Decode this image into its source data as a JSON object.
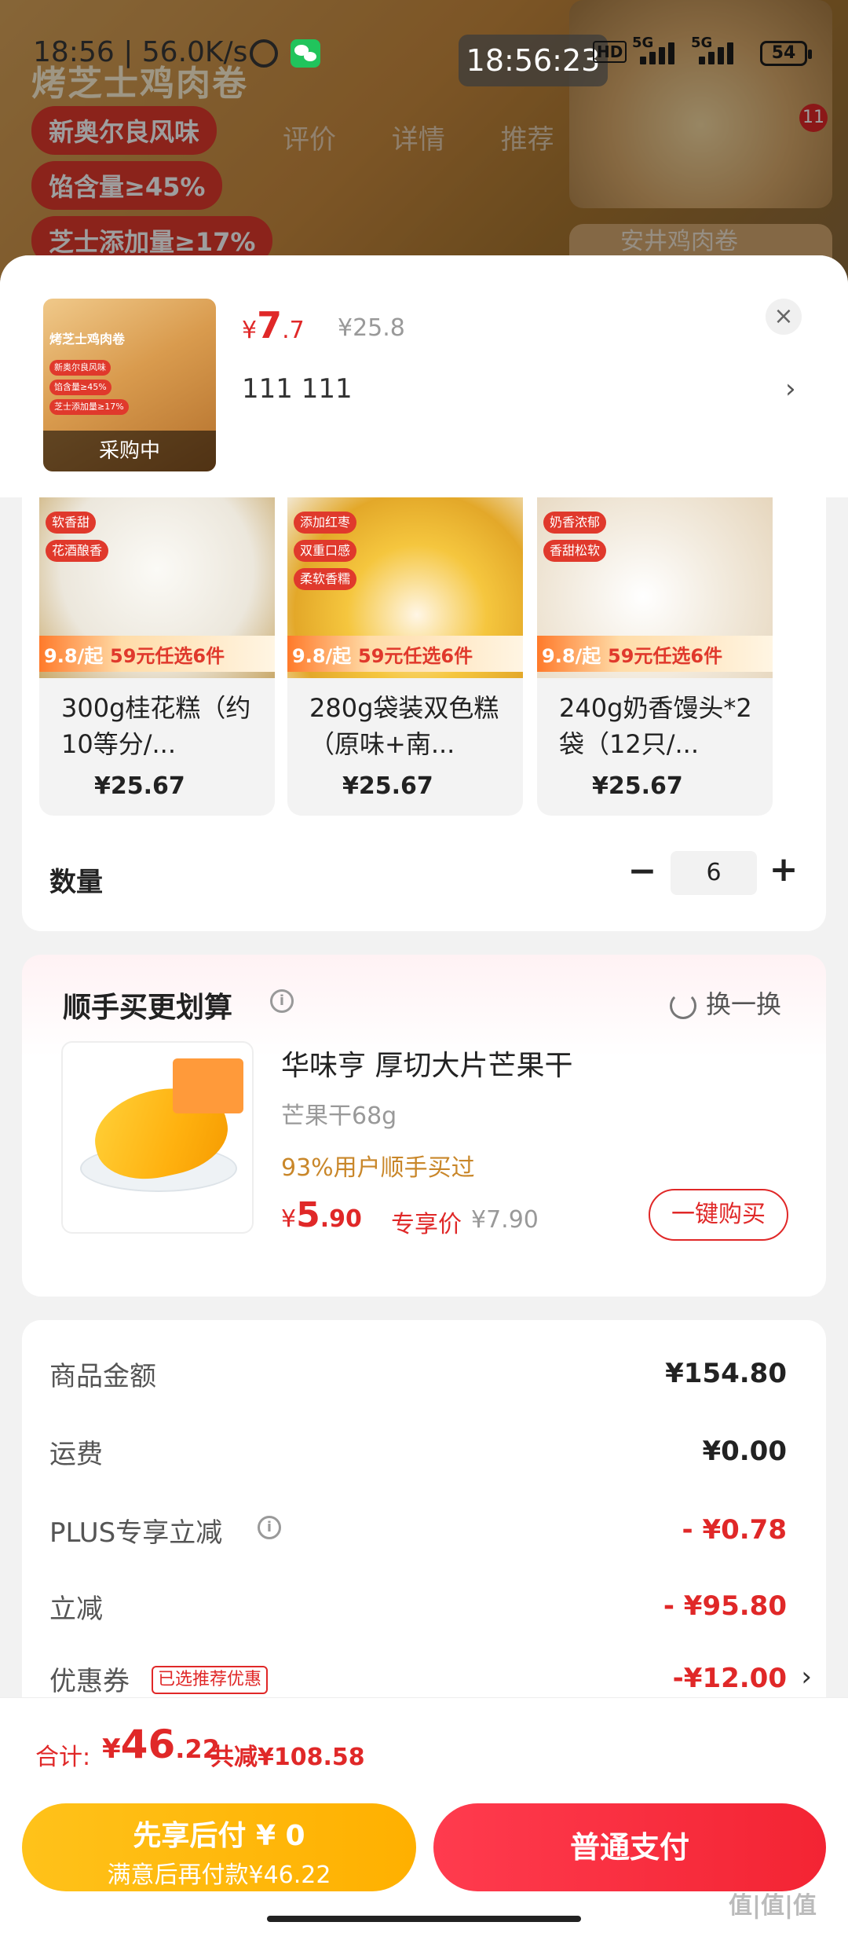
{
  "status_bar": {
    "left_text": "18:56 | 56.0K/s",
    "center_time": "18:56:23",
    "hd_label": "HD",
    "network_1": "5G",
    "network_2": "5G",
    "battery": "54"
  },
  "background": {
    "title": "烤芝士鸡肉卷",
    "badges": [
      "新奥尔良风味",
      "馅含量≥45%",
      "芝士添加量≥17%"
    ],
    "tabs_text": "评价 详情 推荐",
    "right_label": "安井鸡肉卷",
    "cart_count": "11"
  },
  "product_header": {
    "thumb_title": "烤芝士鸡肉卷",
    "thumb_chips": [
      "新奥尔良风味",
      "馅含量≥45%",
      "芝士添加量≥17%"
    ],
    "thumb_status": "采购中",
    "price_symbol": "¥",
    "price_int": "7",
    "price_dec": ".7",
    "price_original": "¥25.8",
    "selected_spec": "111  111",
    "chevron": "›",
    "close": "×"
  },
  "variants": [
    {
      "name": "300g桂花糕（约10等分/...",
      "price": "¥25.67",
      "tags": [
        "软香甜",
        "花酒酿香"
      ],
      "promo_price": "9.8/起",
      "promo_text": "59元任选6件",
      "color": "#e9e4da"
    },
    {
      "name": "280g袋装双色糕（原味+南...",
      "price": "¥25.67",
      "tags": [
        "添加红枣",
        "双重口感",
        "柔软香糯"
      ],
      "promo_price": "9.8/起",
      "promo_text": "59元任选6件",
      "color": "#f3c23a"
    },
    {
      "name": "240g奶香馒头*2袋（12只/...",
      "price": "¥25.67",
      "tags": [
        "奶香浓郁",
        "香甜松软"
      ],
      "promo_price": "9.8/起",
      "promo_text": "59元任选6件",
      "color": "#efe6d8"
    }
  ],
  "quantity": {
    "label": "数量",
    "minus": "−",
    "value": "6",
    "plus": "+"
  },
  "upsell": {
    "title": "顺手买更划算",
    "info_icon": "i",
    "refresh_label": "换一换",
    "product_name": "华味亨 厚切大片芒果干",
    "spec": "芒果干68g",
    "social_proof": "93%用户顺手买过",
    "price_symbol": "¥",
    "price_int": "5",
    "price_dec": ".90",
    "price_tag": "专享价",
    "price_original": "¥7.90",
    "buy_label": "一键购买"
  },
  "summary": {
    "rows": [
      {
        "label": "商品金额",
        "value": "¥154.80"
      },
      {
        "label": "运费",
        "value": "¥0.00"
      },
      {
        "label": "PLUS专享立减",
        "value": "- ¥0.78"
      },
      {
        "label": "立减",
        "value": "- ¥95.80"
      },
      {
        "label": "优惠券",
        "value": "-¥12.00"
      }
    ],
    "coupon_chip": "已选推荐优惠",
    "info_icon": "i",
    "chevron": "›"
  },
  "total": {
    "label": "合计:",
    "symbol": "¥",
    "int": "46",
    "dec": ".22",
    "saved": "共减¥108.58"
  },
  "buttons": {
    "pay_later_line1": "先享后付 ¥ 0",
    "pay_later_line2": "满意后再付款¥46.22",
    "pay_now": "普通支付"
  },
  "watermark": "值|值|值"
}
